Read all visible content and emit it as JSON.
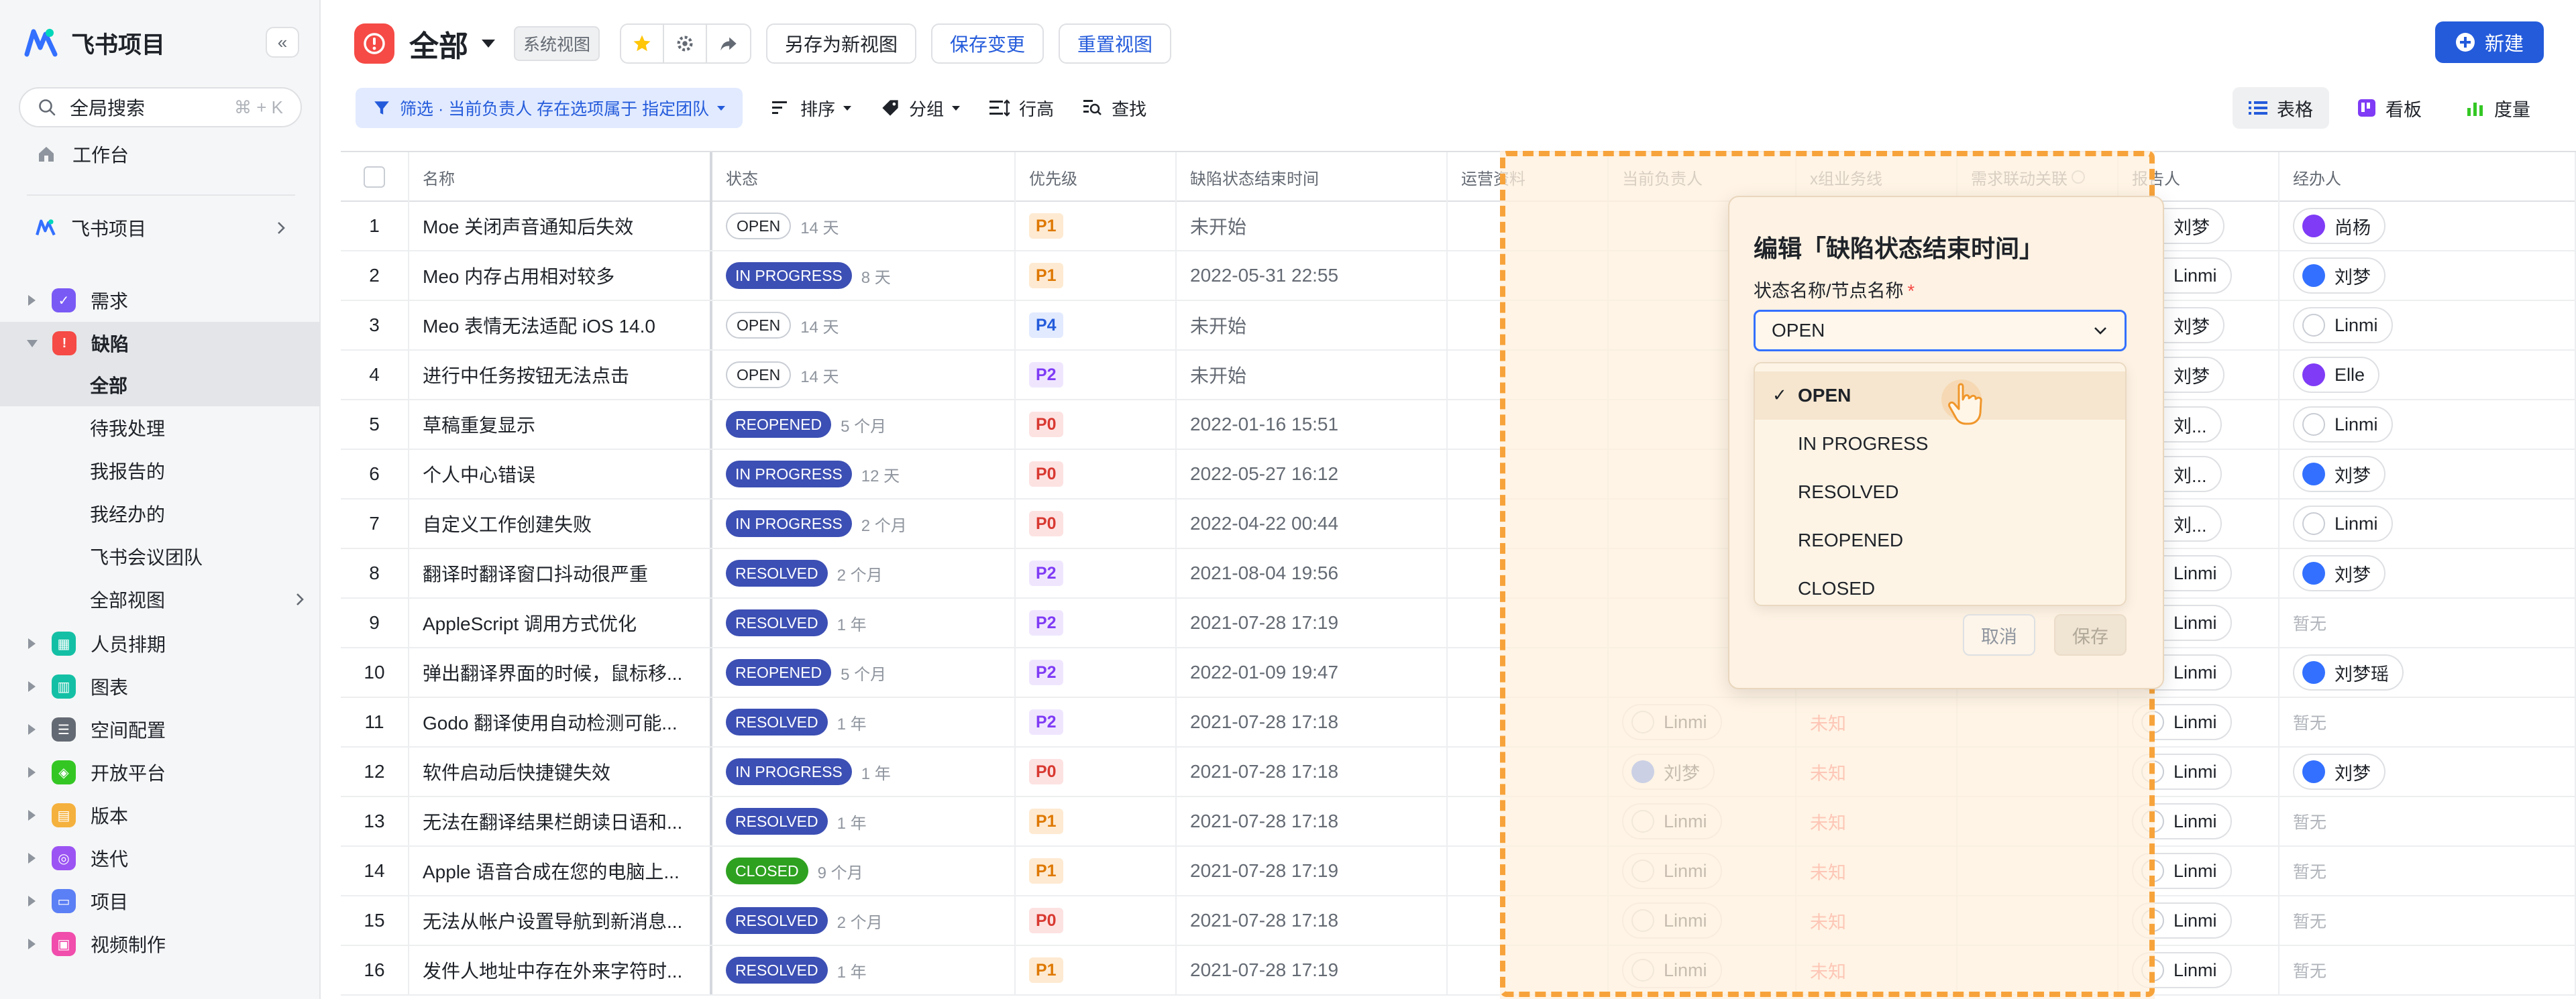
{
  "app": {
    "name": "飞书项目"
  },
  "sidebar": {
    "search": {
      "label": "全局搜索",
      "shortcut": "⌘ + K"
    },
    "workbench": "工作台",
    "project": "飞书项目",
    "sections": [
      {
        "label": "需求",
        "color": "#7a5af5",
        "expanded": false
      },
      {
        "label": "缺陷",
        "color": "#f54a45",
        "expanded": true
      },
      {
        "label": "人员排期",
        "color": "#14c0a5",
        "expanded": false
      },
      {
        "label": "图表",
        "color": "#14c0a5",
        "expanded": false
      },
      {
        "label": "空间配置",
        "color": "#646a73",
        "expanded": false
      },
      {
        "label": "开放平台",
        "color": "#34c724",
        "expanded": false
      },
      {
        "label": "版本",
        "color": "#f5b13d",
        "expanded": false
      },
      {
        "label": "迭代",
        "color": "#9b54f3",
        "expanded": false
      },
      {
        "label": "项目",
        "color": "#5b7ff5",
        "expanded": false
      },
      {
        "label": "视频制作",
        "color": "#f04dac",
        "expanded": false
      }
    ],
    "defect_subitems": [
      "全部",
      "待我处理",
      "我报告的",
      "我经办的",
      "飞书会议团队",
      "全部视图"
    ]
  },
  "toolbar": {
    "view_title": "全部",
    "system_tag": "系统视图",
    "save_as": "另存为新视图",
    "save_changes": "保存变更",
    "reset_view": "重置视图",
    "new_button": "新建"
  },
  "filterbar": {
    "filter": "筛选 · 当前负责人 存在选项属于 指定团队",
    "sort": "排序",
    "group": "分组",
    "row_height": "行高",
    "find": "查找",
    "tabs": {
      "table": "表格",
      "board": "看板",
      "metrics": "度量"
    }
  },
  "table": {
    "headers": [
      "名称",
      "状态",
      "优先级",
      "缺陷状态结束时间",
      "运营资料",
      "当前负责人",
      "x组业务线",
      "需求联动关联",
      "报告人",
      "经办人"
    ],
    "status_colors": {
      "OPEN": "#ffffff",
      "IN PROGRESS": "#3c4fb4",
      "REOPENED": "#3c4fb4",
      "RESOLVED": "#3c4fb4",
      "CLOSED": "#2ea121"
    },
    "priority_colors": {
      "P0": "#d83931",
      "P1": "#de7802",
      "P2": "#7f3bf5",
      "P4": "#245bdb"
    },
    "unknown_label": "未知",
    "empty_label": "暂无",
    "rows": [
      {
        "n": "1",
        "name": "Moe 关闭声音通知后失效",
        "status": "OPEN",
        "age": "14 天",
        "prio": "P1",
        "time": "未开始",
        "owner": "",
        "reporter": "刘梦",
        "assignee": "尚杨"
      },
      {
        "n": "2",
        "name": "Meo 内存占用相对较多",
        "status": "IN PROGRESS",
        "age": "8 天",
        "prio": "P1",
        "time": "2022-05-31 22:55",
        "owner": "",
        "reporter": "Linmi",
        "assignee": "刘梦"
      },
      {
        "n": "3",
        "name": "Meo 表情无法适配 iOS 14.0",
        "status": "OPEN",
        "age": "14 天",
        "prio": "P4",
        "time": "未开始",
        "owner": "",
        "reporter": "刘梦",
        "assignee": "Linmi"
      },
      {
        "n": "4",
        "name": "进行中任务按钮无法点击",
        "status": "OPEN",
        "age": "14 天",
        "prio": "P2",
        "time": "未开始",
        "owner": "",
        "reporter": "刘梦",
        "assignee": "Elle"
      },
      {
        "n": "5",
        "name": "草稿重复显示",
        "status": "REOPENED",
        "age": "5 个月",
        "prio": "P0",
        "time": "2022-01-16 15:51",
        "owner": "",
        "reporter": "刘...",
        "assignee": "Linmi"
      },
      {
        "n": "6",
        "name": "个人中心错误",
        "status": "IN PROGRESS",
        "age": "12 天",
        "prio": "P0",
        "time": "2022-05-27 16:12",
        "owner": "",
        "reporter": "刘...",
        "assignee": "刘梦"
      },
      {
        "n": "7",
        "name": "自定义工作创建失败",
        "status": "IN PROGRESS",
        "age": "2 个月",
        "prio": "P0",
        "time": "2022-04-22 00:44",
        "owner": "",
        "reporter": "刘...",
        "assignee": "Linmi"
      },
      {
        "n": "8",
        "name": "翻译时翻译窗口抖动很严重",
        "status": "RESOLVED",
        "age": "2 个月",
        "prio": "P2",
        "time": "2021-08-04 19:56",
        "owner": "",
        "reporter": "Linmi",
        "assignee": "刘梦"
      },
      {
        "n": "9",
        "name": "AppleScript 调用方式优化",
        "status": "RESOLVED",
        "age": "1 年",
        "prio": "P2",
        "time": "2021-07-28 17:19",
        "owner": "",
        "reporter": "Linmi",
        "assignee": ""
      },
      {
        "n": "10",
        "name": "弹出翻译界面的时候，鼠标移...",
        "status": "REOPENED",
        "age": "5 个月",
        "prio": "P2",
        "time": "2022-01-09 19:47",
        "owner": "",
        "reporter": "Linmi",
        "assignee": "刘梦瑶"
      },
      {
        "n": "11",
        "name": "Godo 翻译使用自动检测可能...",
        "status": "RESOLVED",
        "age": "1 年",
        "prio": "P2",
        "time": "2021-07-28 17:18",
        "owner": "Linmi",
        "reporter": "Linmi",
        "assignee": ""
      },
      {
        "n": "12",
        "name": "软件启动后快捷键失效",
        "status": "IN PROGRESS",
        "age": "1 年",
        "prio": "P0",
        "time": "2021-07-28 17:18",
        "owner": "刘梦",
        "reporter": "Linmi",
        "assignee": "刘梦"
      },
      {
        "n": "13",
        "name": "无法在翻译结果栏朗读日语和...",
        "status": "RESOLVED",
        "age": "1 年",
        "prio": "P1",
        "time": "2021-07-28 17:18",
        "owner": "Linmi",
        "reporter": "Linmi",
        "assignee": ""
      },
      {
        "n": "14",
        "name": "Apple 语音合成在您的电脑上...",
        "status": "CLOSED",
        "age": "9 个月",
        "prio": "P1",
        "time": "2021-07-28 17:19",
        "owner": "Linmi",
        "reporter": "Linmi",
        "assignee": ""
      },
      {
        "n": "15",
        "name": "无法从帐户设置导航到新消息...",
        "status": "RESOLVED",
        "age": "2 个月",
        "prio": "P0",
        "time": "2021-07-28 17:18",
        "owner": "Linmi",
        "reporter": "Linmi",
        "assignee": ""
      },
      {
        "n": "16",
        "name": "发件人地址中存在外来字符时...",
        "status": "RESOLVED",
        "age": "1 年",
        "prio": "P1",
        "time": "2021-07-28 17:19",
        "owner": "Linmi",
        "reporter": "Linmi",
        "assignee": ""
      }
    ]
  },
  "popup": {
    "title": "编辑「缺陷状态结束时间」",
    "field_label": "状态名称/节点名称",
    "required_mark": "*",
    "selected": "OPEN",
    "options": [
      "OPEN",
      "IN PROGRESS",
      "RESOLVED",
      "REOPENED",
      "CLOSED"
    ],
    "cancel": "取消",
    "save": "保存"
  }
}
